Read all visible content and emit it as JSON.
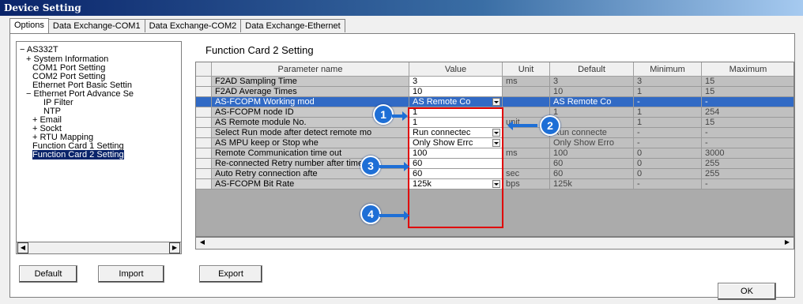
{
  "window": {
    "title": "Device Setting"
  },
  "tabs": [
    "Options",
    "Data Exchange-COM1",
    "Data Exchange-COM2",
    "Data Exchange-Ethernet"
  ],
  "tree": {
    "root": "AS332T",
    "items": [
      {
        "label": "System Information",
        "expander": "+"
      },
      {
        "label": "COM1 Port Setting",
        "expander": ""
      },
      {
        "label": "COM2 Port Setting",
        "expander": ""
      },
      {
        "label": "Ethernet Port Basic Settin",
        "expander": ""
      },
      {
        "label": "Ethernet Port Advance Se",
        "expander": "−"
      },
      {
        "label": "IP Filter",
        "expander": ""
      },
      {
        "label": "NTP",
        "expander": ""
      },
      {
        "label": "Email",
        "expander": "+"
      },
      {
        "label": "Sockt",
        "expander": "+"
      },
      {
        "label": "RTU Mapping",
        "expander": "+"
      },
      {
        "label": "Function Card 1 Setting",
        "expander": ""
      },
      {
        "label": "Function Card 2 Setting",
        "expander": ""
      }
    ],
    "selected_index": 11
  },
  "section_title": "Function Card 2 Setting",
  "grid": {
    "headers": [
      "Parameter name",
      "Value",
      "Unit",
      "Default",
      "Minimum",
      "Maximum"
    ],
    "rows": [
      {
        "name": "F2AD Sampling Time",
        "value": "3",
        "unit": "ms",
        "default": "3",
        "min": "3",
        "max": "15",
        "dropdown": false
      },
      {
        "name": "F2AD Average Times",
        "value": "10",
        "unit": "",
        "default": "10",
        "min": "1",
        "max": "15",
        "dropdown": false
      },
      {
        "name": "AS-FCOPM Working mod",
        "value": "AS Remote Co",
        "unit": "",
        "default": "AS Remote Co",
        "min": "-",
        "max": "-",
        "dropdown": true
      },
      {
        "name": "AS-FCOPM node ID",
        "value": "1",
        "unit": "",
        "default": "1",
        "min": "1",
        "max": "254",
        "dropdown": false
      },
      {
        "name": "AS Remote module No.",
        "value": "1",
        "unit": "unit",
        "default": "1",
        "min": "1",
        "max": "15",
        "dropdown": false
      },
      {
        "name": "Select Run mode after detect remote mo",
        "value": "Run connectec",
        "unit": "",
        "default": "Run connecte",
        "min": "-",
        "max": "-",
        "dropdown": true
      },
      {
        "name": "AS MPU keep or Stop whe",
        "value": "Only Show Errc",
        "unit": "",
        "default": "Only Show Erro",
        "min": "-",
        "max": "-",
        "dropdown": true
      },
      {
        "name": "Remote Communication time out",
        "value": "100",
        "unit": "ms",
        "default": "100",
        "min": "0",
        "max": "3000",
        "dropdown": false
      },
      {
        "name": "Re-connected Retry number after time c",
        "value": "60",
        "unit": "",
        "default": "60",
        "min": "0",
        "max": "255",
        "dropdown": false
      },
      {
        "name": "Auto Retry connection afte",
        "value": "60",
        "unit": "sec",
        "default": "60",
        "min": "0",
        "max": "255",
        "dropdown": false
      },
      {
        "name": "AS-FCOPM Bit Rate",
        "value": "125k",
        "unit": "bps",
        "default": "125k",
        "min": "-",
        "max": "-",
        "dropdown": true
      }
    ],
    "selected_row": 2
  },
  "callouts": [
    "1",
    "2",
    "3",
    "4"
  ],
  "buttons": {
    "default": "Default",
    "import": "Import",
    "export": "Export",
    "ok": "OK"
  },
  "colors": {
    "callout": "#1e6fd6",
    "highlight_box": "#e00000",
    "selection": "#316ac5"
  }
}
